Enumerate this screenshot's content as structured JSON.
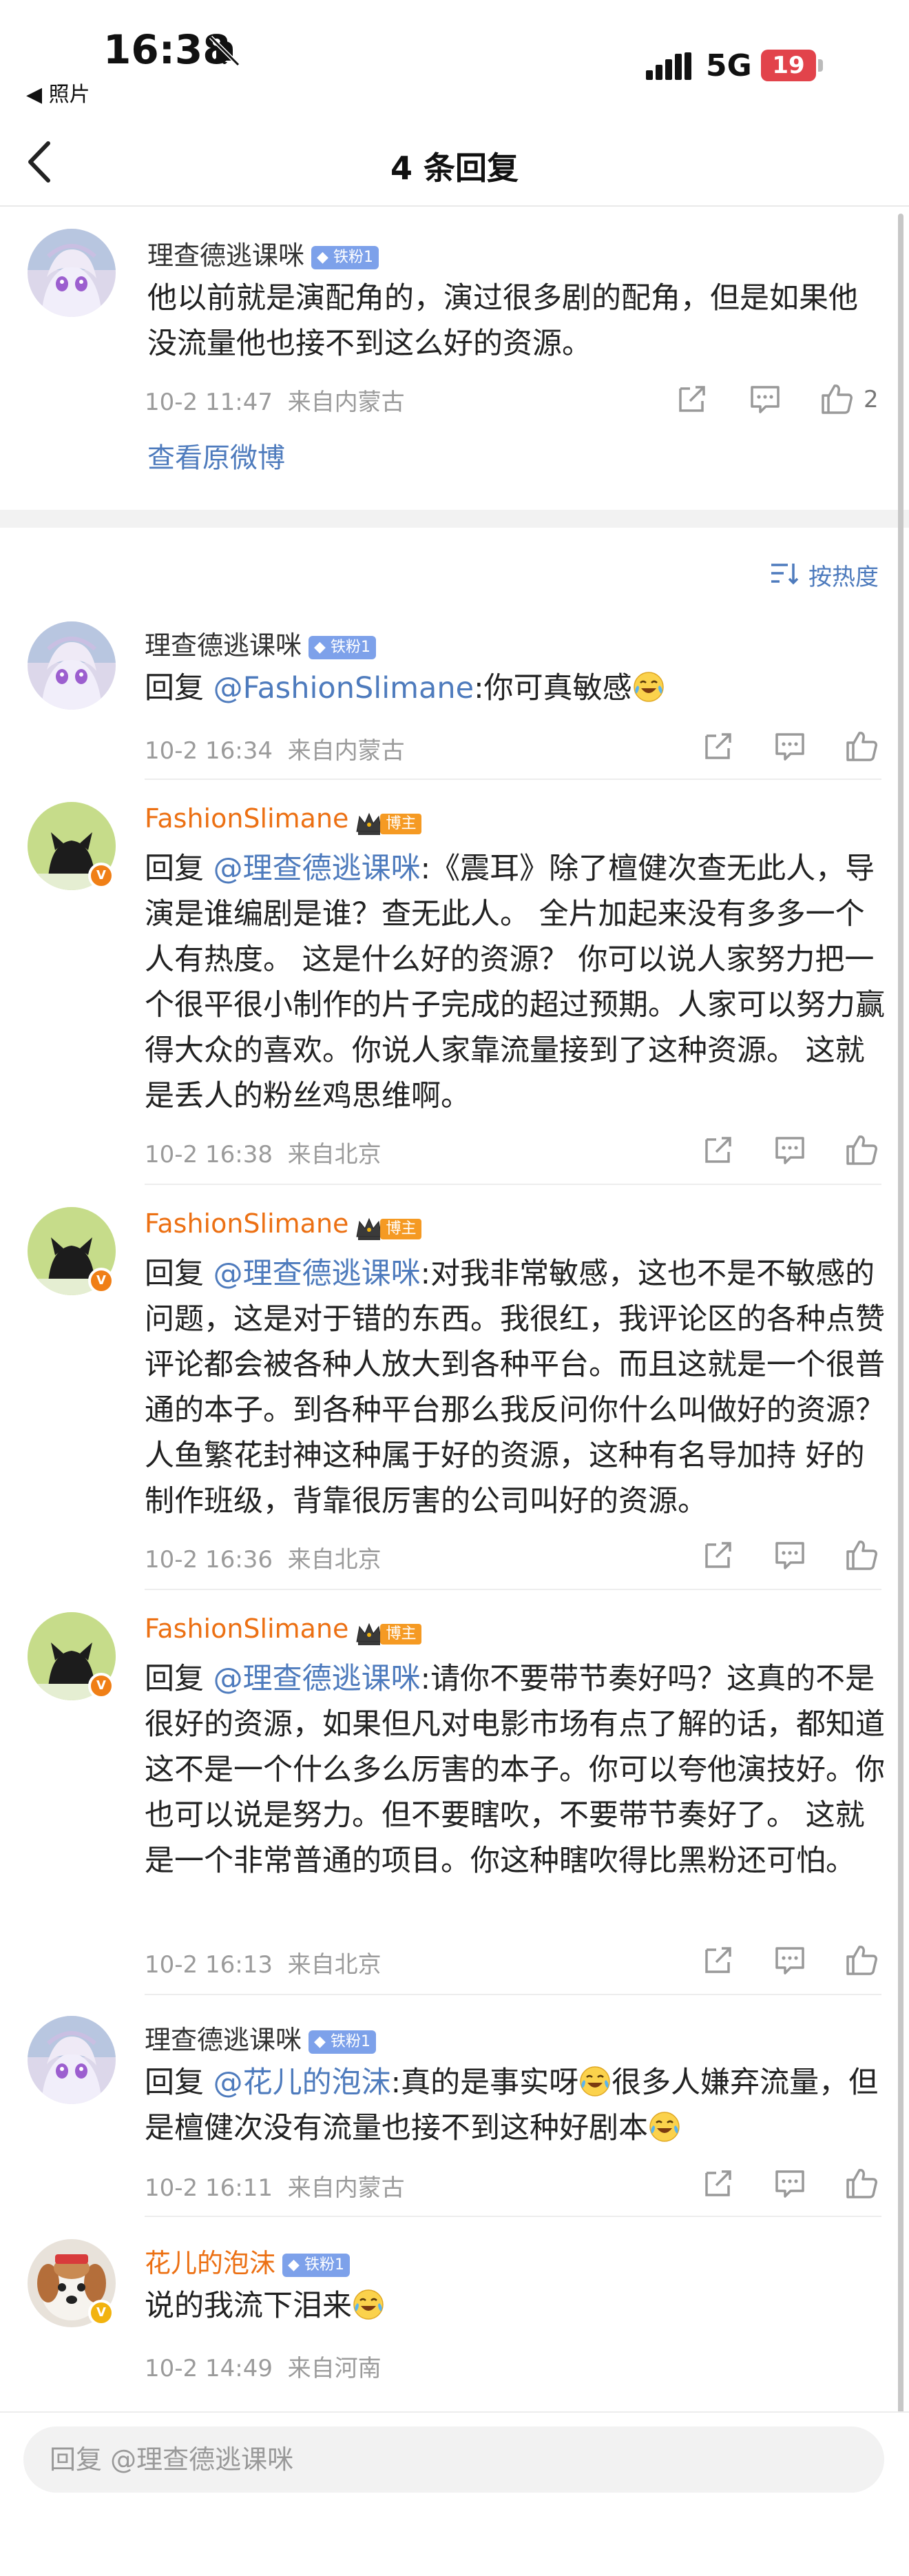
{
  "status_bar": {
    "time": "16:38",
    "back_app": "◀ 照片",
    "network": "5G",
    "battery": "19"
  },
  "nav": {
    "title": "4 条回复"
  },
  "root_comment": {
    "username": "理查德逃课咪",
    "fan_badge": "铁粉1",
    "text": "他以前就是演配角的，演过很多剧的配角，但是如果他没流量他也接不到这么好的资源。",
    "date": "10-2 11:47",
    "location": "来自内蒙古",
    "like_count": "2",
    "view_original": "查看原微博"
  },
  "sort_label": "按热度",
  "replies": [
    {
      "username": "理查德逃课咪",
      "badge_type": "fan",
      "badge": "铁粉1",
      "prefix": "回复 ",
      "mention": "@FashionSlimane",
      "text": ":你可真敏感",
      "date": "10-2 16:34",
      "location": "来自内蒙古"
    },
    {
      "username": "FashionSlimane",
      "badge_type": "owner",
      "badge": "博主",
      "prefix": "回复 ",
      "mention": "@理查德逃课咪",
      "text": ":《震耳》除了檀健次查无此人，导演是谁编剧是谁？查无此人。 全片加起来没有多多一个人有热度。 这是什么好的资源？ 你可以说人家努力把一个很平很小制作的片子完成的超过预期。人家可以努力赢得大众的喜欢。你说人家靠流量接到了这种资源。 这就是丢人的粉丝鸡思维啊。",
      "date": "10-2 16:38",
      "location": "来自北京"
    },
    {
      "username": "FashionSlimane",
      "badge_type": "owner",
      "badge": "博主",
      "prefix": "回复 ",
      "mention": "@理查德逃课咪",
      "text": ":对我非常敏感，这也不是不敏感的问题，这是对于错的东西。我很红，我评论区的各种点赞评论都会被各种人放大到各种平台。而且这就是一个很普通的本子。到各种平台那么我反问你什么叫做好的资源？ 人鱼繁花封神这种属于好的资源，这种有名导加持 好的制作班级，背靠很厉害的公司叫好的资源。",
      "date": "10-2 16:36",
      "location": "来自北京"
    },
    {
      "username": "FashionSlimane",
      "badge_type": "owner",
      "badge": "博主",
      "prefix": "回复 ",
      "mention": "@理查德逃课咪",
      "text": ":请你不要带节奏好吗？这真的不是很好的资源，如果但凡对电影市场有点了解的话，都知道这不是一个什么多么厉害的本子。你可以夸他演技好。你也可以说是努力。但不要瞎吹，不要带节奏好了。 这就是一个非常普通的项目。你这种瞎吹得比黑粉还可怕。",
      "date": "10-2 16:13",
      "location": "来自北京"
    },
    {
      "username": "理查德逃课咪",
      "badge_type": "fan",
      "badge": "铁粉1",
      "prefix": "回复 ",
      "mention": "@花儿的泡沫",
      "text_parts": [
        ":真的是事实呀",
        "很多人嫌弃流量，但是檀健次没有流量也接不到这种好剧本"
      ],
      "date": "10-2 16:11",
      "location": "来自内蒙古"
    },
    {
      "username": "花儿的泡沫",
      "badge_type": "fan",
      "badge": "铁粉1",
      "text_parts": [
        "说的我流下泪来"
      ],
      "date": "10-2 14:49",
      "location": "来自河南"
    }
  ],
  "reply_bar": {
    "placeholder": "回复 @理查德逃课咪"
  },
  "colors": {
    "link": "#4e7bbd",
    "owner_name": "#ec7013",
    "fan_badge": "#7da1ea",
    "owner_tag": "#f59a23",
    "battery": "#e2434b"
  },
  "icons": [
    "bell-slash-icon",
    "signal-icon",
    "back-arrow-icon",
    "share-icon",
    "comment-icon",
    "like-icon",
    "sort-icon",
    "laugh-cry-emoji"
  ]
}
